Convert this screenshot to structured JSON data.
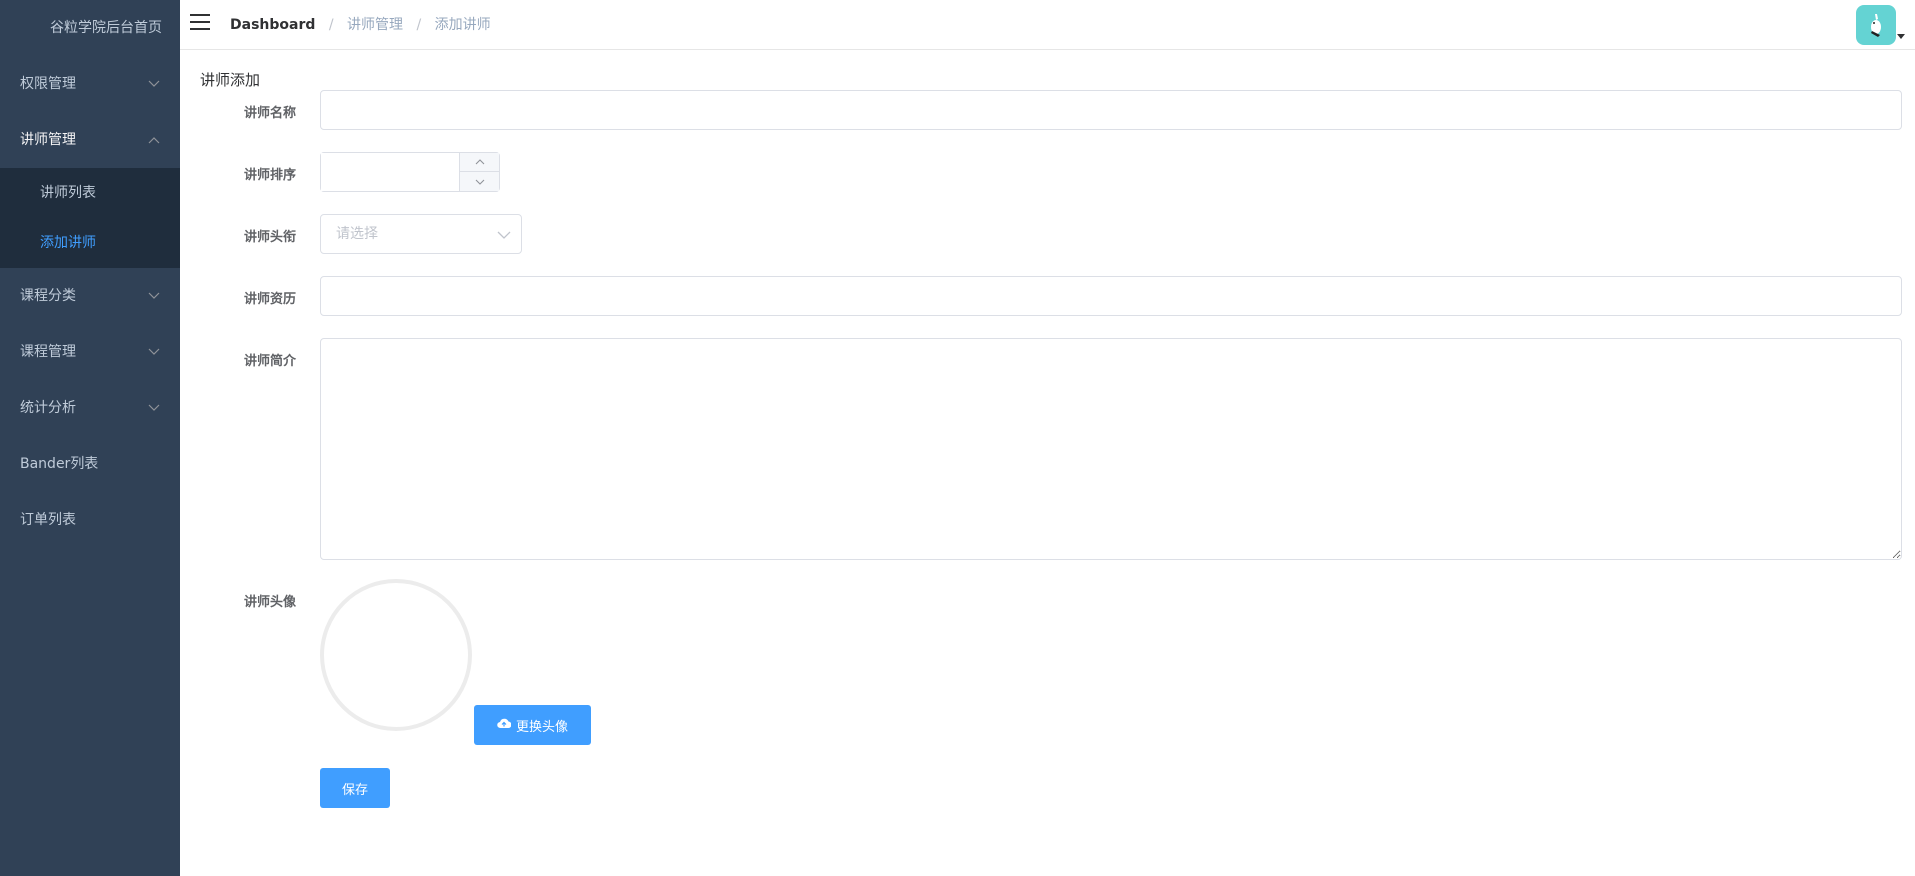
{
  "sidebar": {
    "brand": "谷粒学院后台首页",
    "items": [
      {
        "label": "权限管理",
        "has_arrow": true,
        "expanded": false
      },
      {
        "label": "讲师管理",
        "has_arrow": true,
        "expanded": true,
        "children": [
          {
            "label": "讲师列表",
            "active": false
          },
          {
            "label": "添加讲师",
            "active": true
          }
        ]
      },
      {
        "label": "课程分类",
        "has_arrow": true,
        "expanded": false
      },
      {
        "label": "课程管理",
        "has_arrow": true,
        "expanded": false
      },
      {
        "label": "统计分析",
        "has_arrow": true,
        "expanded": false
      },
      {
        "label": "Bander列表",
        "has_arrow": false
      },
      {
        "label": "订单列表",
        "has_arrow": false
      }
    ],
    "bg_color": "#304156",
    "active_color": "#409eff"
  },
  "navbar": {
    "breadcrumb": [
      "Dashboard",
      "讲师管理",
      "添加讲师"
    ],
    "separator": "/",
    "avatar_icon": "user-avatar-icon"
  },
  "form": {
    "title": "讲师添加",
    "name_label": "讲师名称",
    "name_value": "",
    "sort_label": "讲师排序",
    "sort_value": "",
    "level_label": "讲师头衔",
    "level_placeholder": "请选择",
    "career_label": "讲师资历",
    "career_value": "",
    "intro_label": "讲师简介",
    "intro_value": "",
    "avatar_label": "讲师头像",
    "change_avatar_button": "更换头像",
    "save_button": "保存",
    "primary_color": "#409eff"
  }
}
